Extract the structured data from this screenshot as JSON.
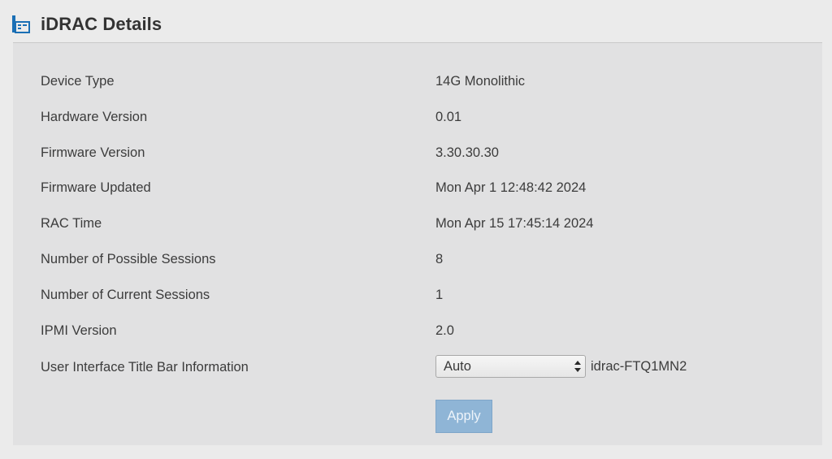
{
  "header": {
    "title": "iDRAC Details",
    "icon": "server-info-icon"
  },
  "details": {
    "rows": [
      {
        "label": "Device Type",
        "value": "14G Monolithic"
      },
      {
        "label": "Hardware Version",
        "value": "0.01"
      },
      {
        "label": "Firmware Version",
        "value": "3.30.30.30"
      },
      {
        "label": "Firmware Updated",
        "value": "Mon Apr 1 12:48:42 2024"
      },
      {
        "label": "RAC Time",
        "value": "Mon Apr 15 17:45:14 2024"
      },
      {
        "label": "Number of Possible Sessions",
        "value": "8"
      },
      {
        "label": "Number of Current Sessions",
        "value": "1"
      },
      {
        "label": "IPMI Version",
        "value": "2.0"
      }
    ],
    "title_bar": {
      "label": "User Interface Title Bar Information",
      "selected": "Auto",
      "hostname": "idrac-FTQ1MN2"
    },
    "apply_label": "Apply"
  },
  "colors": {
    "accent": "#1a6fb5",
    "apply_button": "#8fb5d6",
    "panel": "#e1e1e2"
  }
}
